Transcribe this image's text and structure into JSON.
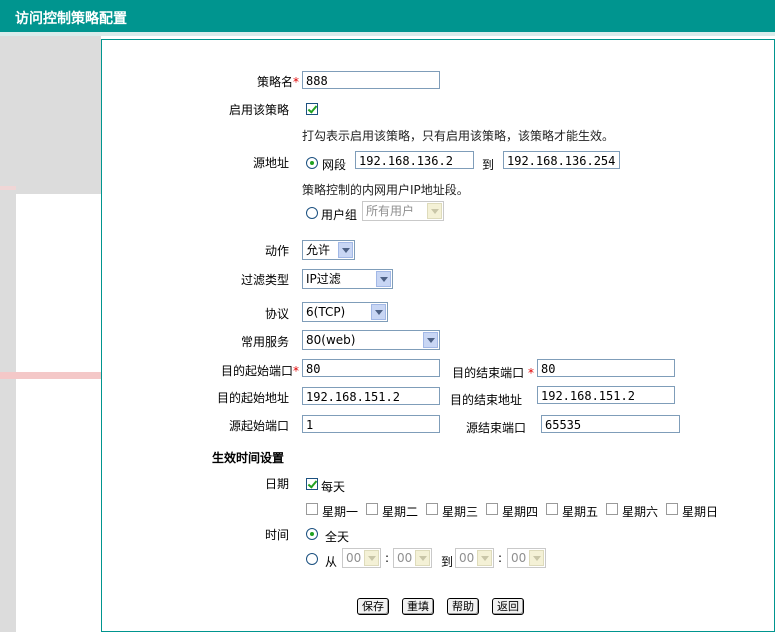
{
  "page_title": "访问控制策略配置",
  "policy_name": {
    "label": "策略名",
    "required": "*",
    "value": "888"
  },
  "enable": {
    "label": "启用该策略",
    "checked": true,
    "hint": "打勾表示启用该策略，只有启用该策略，该策略才能生效。"
  },
  "source": {
    "label": "源地址",
    "segment_label": "网段",
    "segment_selected": true,
    "start_ip": "192.168.136.2",
    "to_label": "到",
    "end_ip": "192.168.136.254",
    "hint": "策略控制的内网用户IP地址段。",
    "group_label": "用户组",
    "group_value": "所有用户"
  },
  "action": {
    "label": "动作",
    "value": "允许"
  },
  "filter_type": {
    "label": "过滤类型",
    "value": "IP过滤"
  },
  "protocol": {
    "label": "协议",
    "value": "6(TCP)"
  },
  "common_service": {
    "label": "常用服务",
    "value": "80(web)"
  },
  "dest_start_port": {
    "label": "目的起始端口",
    "required": "*",
    "value": "80"
  },
  "dest_end_port": {
    "label": "目的结束端口",
    "required": "*",
    "value": "80"
  },
  "dest_start_addr": {
    "label": "目的起始地址",
    "value": "192.168.151.2"
  },
  "dest_end_addr": {
    "label": "目的结束地址",
    "value": "192.168.151.2"
  },
  "src_start_port": {
    "label": "源起始端口",
    "value": "1"
  },
  "src_end_port": {
    "label": "源结束端口",
    "value": "65535"
  },
  "schedule": {
    "section_title": "生效时间设置",
    "date_label": "日期",
    "everyday_label": "每天",
    "everyday_checked": true,
    "weekdays": [
      "星期一",
      "星期二",
      "星期三",
      "星期四",
      "星期五",
      "星期六",
      "星期日"
    ],
    "time_label": "时间",
    "allday_label": "全天",
    "allday_selected": true,
    "from_label": "从",
    "to_label": "到",
    "colon": ":",
    "from_hour": "00",
    "from_min": "00",
    "to_hour": "00",
    "to_min": "00"
  },
  "buttons": {
    "save": "保存",
    "reset": "重填",
    "help": "帮助",
    "back": "返回"
  },
  "colors": {
    "titlebar": "#00958f",
    "required": "#e00000",
    "check": "#21a121"
  }
}
